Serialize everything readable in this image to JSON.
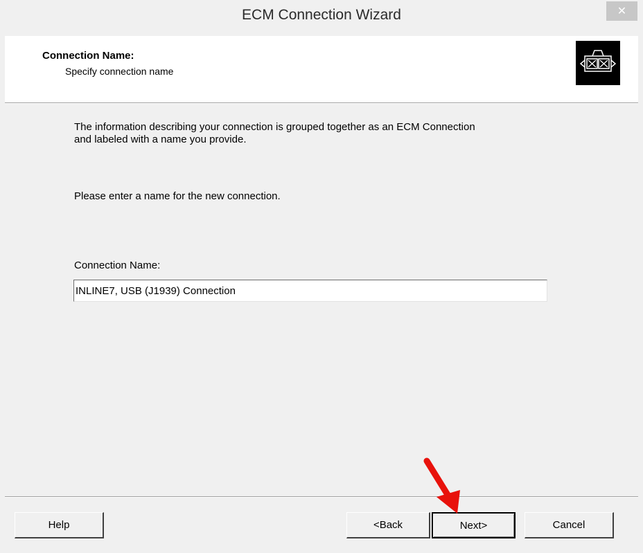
{
  "window": {
    "title": "ECM Connection Wizard",
    "close_glyph": "✕"
  },
  "header": {
    "title": "Connection Name:",
    "subtitle": "Specify connection name",
    "icon": "ecm-connector-icon"
  },
  "body": {
    "intro_line1": "The information describing your connection is grouped together as an ECM Connection",
    "intro_line2": "and labeled with a name you provide.",
    "prompt": "Please enter a name for the new connection.",
    "field_label": "Connection Name:",
    "field_value": "INLINE7, USB (J1939) Connection"
  },
  "buttons": {
    "help": "Help",
    "back": "<Back",
    "next": "Next>",
    "cancel": "Cancel"
  },
  "annotation": {
    "arrow_icon": "red-arrow-icon",
    "arrow_color": "#e8120c"
  }
}
